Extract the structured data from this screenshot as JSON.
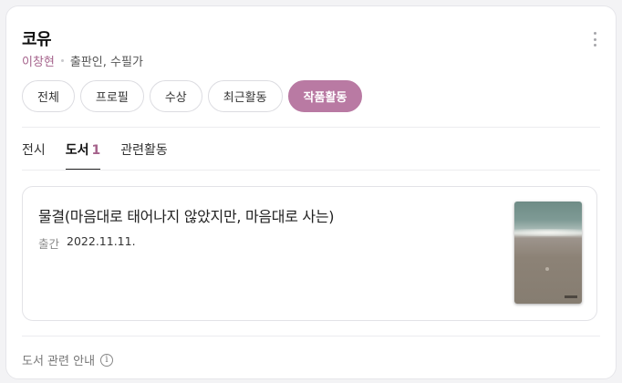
{
  "profile": {
    "title": "코유",
    "name": "이창현",
    "roles": "출판인, 수필가"
  },
  "chips": [
    {
      "label": "전체"
    },
    {
      "label": "프로필"
    },
    {
      "label": "수상"
    },
    {
      "label": "최근활동"
    },
    {
      "label": "작품활동",
      "active": true
    }
  ],
  "subtabs": {
    "exhibition": "전시",
    "books": "도서",
    "books_count": "1",
    "related": "관련활동"
  },
  "book": {
    "title": "물결(마음대로 태어나지 않았지만, 마음대로 사는)",
    "published_label": "출간",
    "published_date": "2022.11.11."
  },
  "footer": {
    "info_text": "도서 관련 안내",
    "info_icon": "i"
  },
  "colors": {
    "accent": "#b97aa3",
    "name_text": "#a5628b"
  }
}
